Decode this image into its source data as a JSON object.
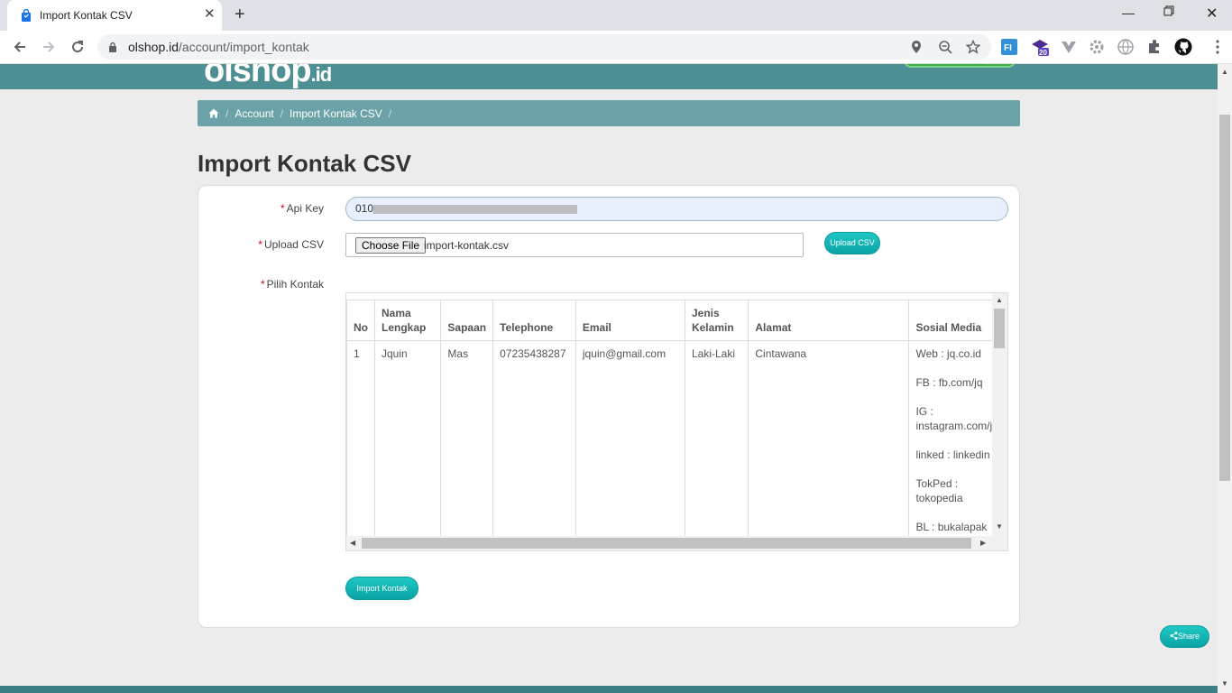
{
  "browser": {
    "tab_title": "Import Kontak CSV",
    "url_host": "olshop.id",
    "url_path": "/account/import_kontak",
    "extension_badge": "20"
  },
  "site": {
    "logo_text": "olshop",
    "logo_suffix": ".id"
  },
  "breadcrumb": {
    "items": [
      "Account",
      "Import Kontak CSV"
    ]
  },
  "page": {
    "title": "Import Kontak CSV"
  },
  "form": {
    "api_key_label": "Api Key",
    "api_key_value": "010",
    "upload_label": "Upload CSV",
    "choose_file_label": "Choose File",
    "file_name": "import-kontak.csv",
    "upload_button": "Upload CSV",
    "pilih_label": "Pilih Kontak",
    "import_button": "Import Kontak",
    "required_mark": "*"
  },
  "table": {
    "headers": {
      "no": "No",
      "nama_1": "Nama",
      "nama_2": "Lengkap",
      "sapaan": "Sapaan",
      "telephone": "Telephone",
      "email": "Email",
      "jk_1": "Jenis",
      "jk_2": "Kelamin",
      "alamat": "Alamat",
      "sosial": "Sosial Media"
    },
    "rows": [
      {
        "no": "1",
        "nama": "Jquin",
        "sapaan": "Mas",
        "telephone": "07235438287",
        "email": "jquin@gmail.com",
        "jenis_kelamin": "Laki-Laki",
        "alamat": "Cintawana",
        "sosial": [
          "Web : jq.co.id",
          "FB : fb.com/jq",
          "IG :",
          "instagram.com/jq",
          "linked : linkedin",
          "TokPed :",
          "tokopedia",
          "BL : bukalapak"
        ]
      }
    ]
  },
  "share_button": "Share",
  "colors": {
    "header": "#4e8f94",
    "breadcrumb": "#6aa2a8",
    "accent_teal": "#0fb5b5",
    "required": "#d0021b"
  }
}
